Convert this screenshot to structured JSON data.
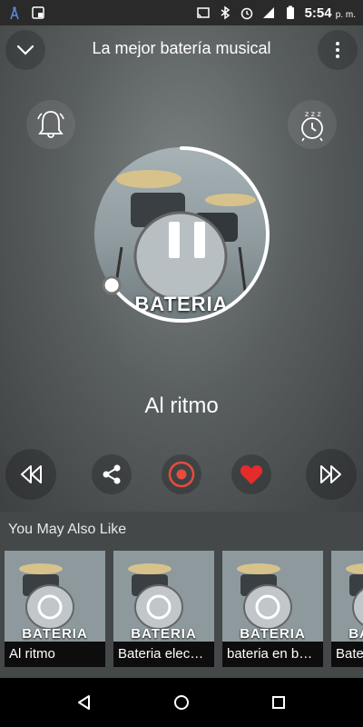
{
  "status_bar": {
    "time": "5:54",
    "time_suffix": "p. m.",
    "icons": [
      "signal-tower-icon",
      "wallpaper-icon",
      "cast-icon",
      "bluetooth-icon",
      "alarm-icon",
      "cellular-icon",
      "battery-icon"
    ]
  },
  "header": {
    "title": "La mejor batería musical",
    "collapse_icon": "chevron-down-icon",
    "menu_icon": "more-vert-icon"
  },
  "player": {
    "track_name": "Al ritmo",
    "artwork_text": "BATERIA",
    "progress": 0.65,
    "state": "playing",
    "left_action_icon": "bell-icon",
    "right_action_icon": "sleep-timer-icon"
  },
  "controls": {
    "rewind_icon": "rewind-icon",
    "share_icon": "share-icon",
    "record_icon": "record-icon",
    "favorite_icon": "heart-icon",
    "forward_icon": "fast-forward-icon",
    "record_color": "#e74c3c",
    "favorite_color": "#e52b2b"
  },
  "recommendations": {
    "title": "You May Also Like",
    "items": [
      {
        "label": "Al ritmo",
        "art": "BATERIA"
      },
      {
        "label": "Bateria elec…",
        "art": "BATERIA"
      },
      {
        "label": "bateria en b…",
        "art": "BATERIA"
      },
      {
        "label": "Bate",
        "art": "BATERIA"
      }
    ]
  },
  "nav": {
    "back_icon": "back-triangle-icon",
    "home_icon": "home-circle-icon",
    "recents_icon": "recents-square-icon"
  }
}
